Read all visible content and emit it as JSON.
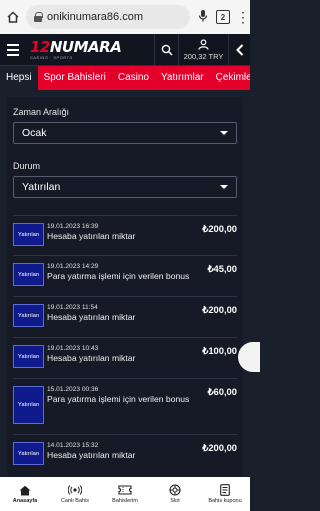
{
  "browser": {
    "url": "onikinumara86.com",
    "tab_count": "2"
  },
  "site": {
    "logo_number": "12",
    "logo_word": "NUMARA",
    "logo_tagline": "CASINO · SPORTS",
    "balance": "200,32 TRY"
  },
  "nav": {
    "tabs": [
      "Hepsi",
      "Spor Bahisleri",
      "Casino",
      "Yatırımlar",
      "Çekimler"
    ]
  },
  "filters": {
    "range_label": "Zaman Aralığı",
    "range_value": "Ocak",
    "status_label": "Durum",
    "status_value": "Yatırılan"
  },
  "transactions": [
    {
      "badge": "Yatırılan",
      "date": "19.01.2023 16:39",
      "desc": "Hesaba yatırılan miktar",
      "amount": "₺200,00"
    },
    {
      "badge": "Yatırılan",
      "date": "19.01.2023 14:29",
      "desc": "Para yatırma işlemi için verilen bonus",
      "amount": "₺45,00"
    },
    {
      "badge": "Yatırılan",
      "date": "19.01.2023 11:54",
      "desc": "Hesaba yatırılan miktar",
      "amount": "₺200,00"
    },
    {
      "badge": "Yatırılan",
      "date": "19.01.2023 10:43",
      "desc": "Hesaba yatırılan miktar",
      "amount": "₺100,00"
    },
    {
      "badge": "Yatırılan",
      "date": "15.01.2023 00:36",
      "desc": "Para yatırma işlemi için verilen bonus",
      "amount": "₺60,00"
    },
    {
      "badge": "Yatırılan",
      "date": "14.01.2023 15:32",
      "desc": "Hesaba yatırılan miktar",
      "amount": "₺200,00"
    }
  ],
  "bottom_nav": [
    {
      "label": "Anasayfa",
      "icon": "home-icon"
    },
    {
      "label": "Canlı Bahis",
      "icon": "live-bet-icon"
    },
    {
      "label": "Bahislerim",
      "icon": "ticket-icon"
    },
    {
      "label": "Slot",
      "icon": "slot-icon"
    },
    {
      "label": "Bahis kuponu",
      "icon": "coupon-icon"
    }
  ]
}
